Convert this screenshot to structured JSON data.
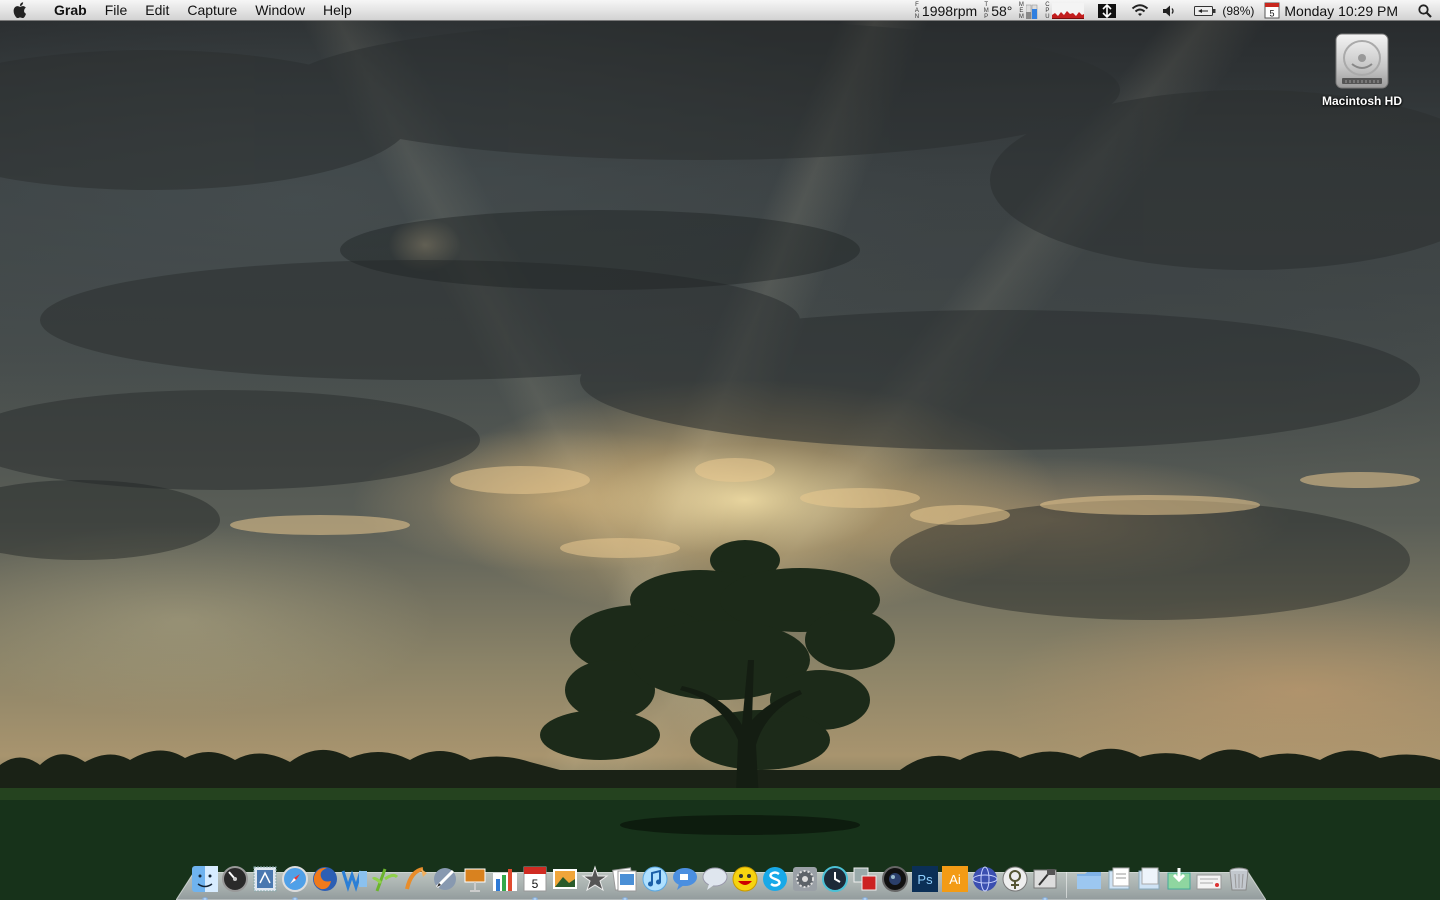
{
  "menubar": {
    "app_name": "Grab",
    "menus": [
      "File",
      "Edit",
      "Capture",
      "Window",
      "Help"
    ],
    "fan": {
      "label": [
        "F",
        "A",
        "N"
      ],
      "value": "1998rpm"
    },
    "temp": {
      "label": [
        "T",
        "M",
        "P"
      ],
      "value": "58°"
    },
    "mem_label": [
      "M",
      "E",
      "M"
    ],
    "cpu_label": [
      "C",
      "P",
      "U"
    ],
    "battery_percent": "(98%)",
    "calendar_day": "5",
    "clock": "Monday 10:29 PM"
  },
  "desktop": {
    "icons": [
      {
        "label": "Macintosh HD",
        "icon": "hard-drive-icon"
      }
    ]
  },
  "dock": {
    "apps": [
      {
        "icon": "finder-icon",
        "running": true
      },
      {
        "icon": "dashboard-icon",
        "running": false
      },
      {
        "icon": "mail-stamp-icon",
        "running": false
      },
      {
        "icon": "safari-icon",
        "running": true
      },
      {
        "icon": "firefox-icon",
        "running": false
      },
      {
        "icon": "word-icon",
        "running": false
      },
      {
        "icon": "bamboo-icon",
        "running": false
      },
      {
        "icon": "pages-icon",
        "running": false
      },
      {
        "icon": "pen-icon",
        "running": false
      },
      {
        "icon": "keynote-icon",
        "running": false
      },
      {
        "icon": "numbers-icon",
        "running": false
      },
      {
        "icon": "ical-icon",
        "running": true,
        "day": "5"
      },
      {
        "icon": "iphoto-icon",
        "running": false
      },
      {
        "icon": "imovie-star-icon",
        "running": false
      },
      {
        "icon": "preview-icon",
        "running": true
      },
      {
        "icon": "itunes-icon",
        "running": false
      },
      {
        "icon": "ichat-icon",
        "running": false
      },
      {
        "icon": "adium-icon",
        "running": false
      },
      {
        "icon": "yahoo-messenger-icon",
        "running": false
      },
      {
        "icon": "skype-icon",
        "running": false
      },
      {
        "icon": "system-preferences-icon",
        "running": false
      },
      {
        "icon": "time-machine-icon",
        "running": false
      },
      {
        "icon": "parallels-icon",
        "running": true
      },
      {
        "icon": "aperture-icon",
        "running": false
      },
      {
        "icon": "photoshop-icon",
        "running": false
      },
      {
        "icon": "illustrator-icon",
        "running": false
      },
      {
        "icon": "globe-icon",
        "running": false
      },
      {
        "icon": "macbook-icon",
        "running": false
      },
      {
        "icon": "grab-icon",
        "running": true
      }
    ],
    "stacks": [
      {
        "icon": "applications-folder-icon"
      },
      {
        "icon": "documents-stack-icon"
      },
      {
        "icon": "pictures-stack-icon"
      },
      {
        "icon": "downloads-stack-icon"
      },
      {
        "icon": "letter-icon"
      },
      {
        "icon": "trash-icon"
      }
    ],
    "labels": {
      "ps": "Ps",
      "ai": "Ai"
    }
  }
}
